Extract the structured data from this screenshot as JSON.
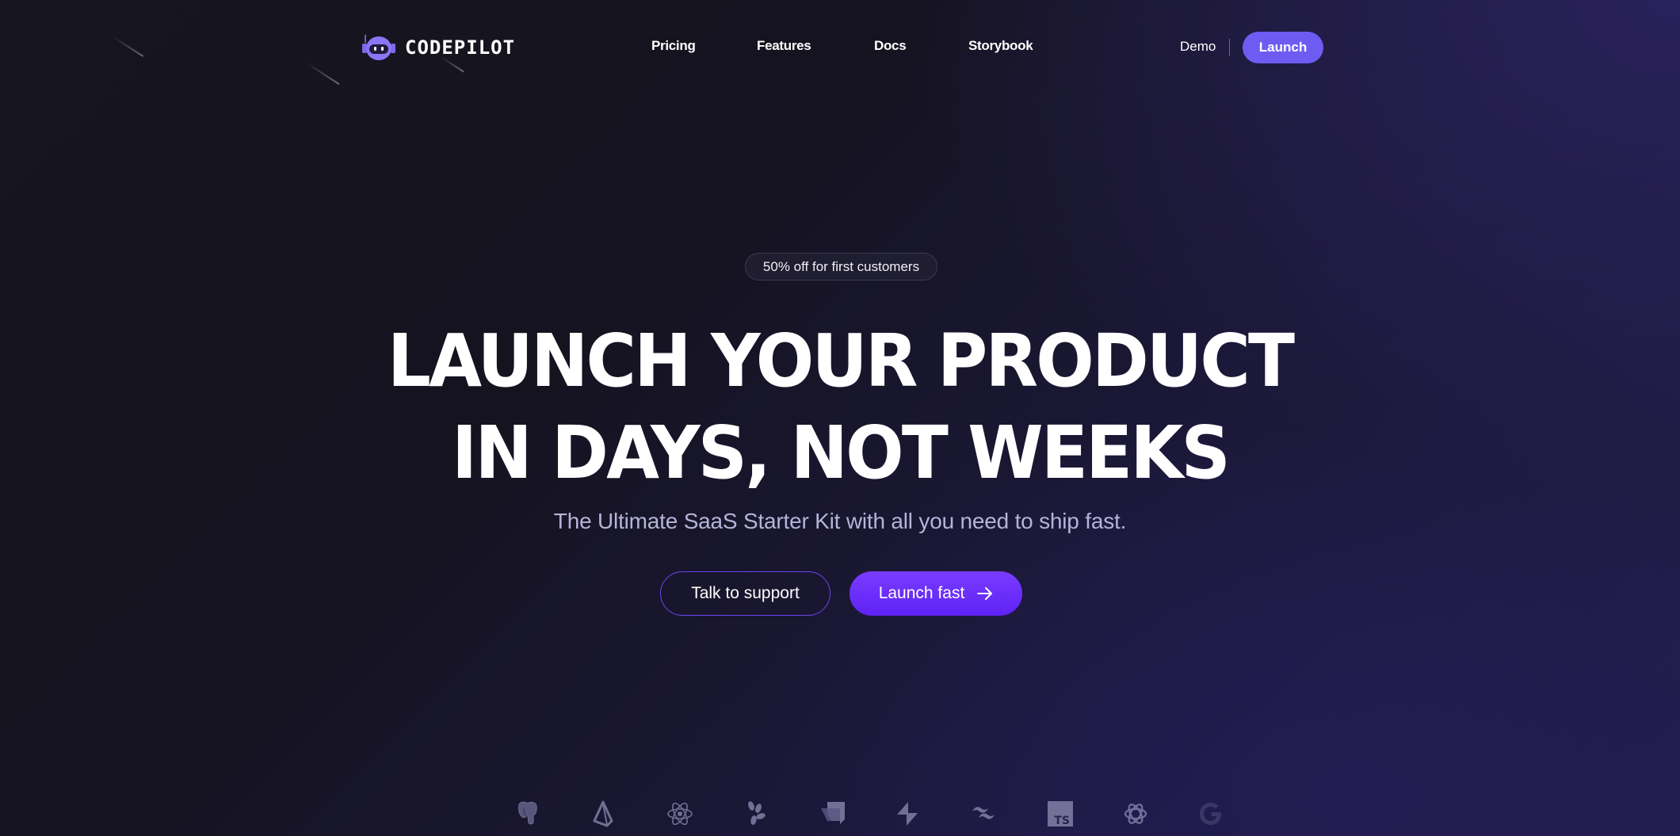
{
  "brand": {
    "name": "CODEPILOT",
    "logo_icon": "robot-helmet-icon",
    "accent_color": "#6e5cf2"
  },
  "nav": {
    "links": [
      {
        "label": "Pricing"
      },
      {
        "label": "Features"
      },
      {
        "label": "Docs"
      },
      {
        "label": "Storybook"
      }
    ],
    "demo_label": "Demo",
    "launch_label": "Launch"
  },
  "hero": {
    "badge": "50% off for first customers",
    "headline_line1": "LAUNCH YOUR PRODUCT",
    "headline_line2": "IN DAYS, NOT WEEKS",
    "subtitle": "The Ultimate SaaS Starter Kit with all you need to ship fast.",
    "secondary_cta": "Talk to support",
    "primary_cta": "Launch fast",
    "primary_cta_icon": "arrow-right-icon"
  },
  "tech_stack": [
    {
      "name": "postgresql-icon"
    },
    {
      "name": "prisma-icon"
    },
    {
      "name": "react-icon"
    },
    {
      "name": "resend-icon"
    },
    {
      "name": "storyblok-icon"
    },
    {
      "name": "supabase-icon"
    },
    {
      "name": "tailwind-icon"
    },
    {
      "name": "typescript-icon",
      "text": "TS"
    },
    {
      "name": "openai-icon"
    },
    {
      "name": "google-icon"
    }
  ]
}
